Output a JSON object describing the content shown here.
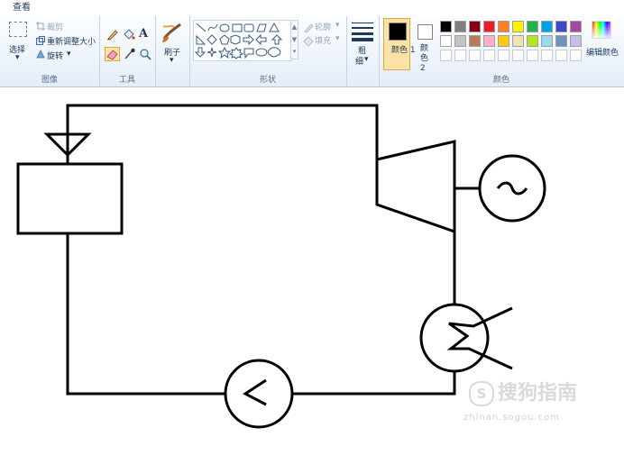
{
  "tabs": {
    "view": "查看"
  },
  "image_group": {
    "select_label": "选择",
    "crop_label": "裁剪",
    "resize_label": "重新调整大小",
    "rotate_label": "旋转",
    "group_label": "图像"
  },
  "tools_group": {
    "text_tool": "A",
    "group_label": "工具"
  },
  "brush_group": {
    "brush_label": "刷子"
  },
  "shapes_group": {
    "outline_label": "轮廓",
    "fill_label": "填充",
    "group_label": "形状"
  },
  "size_group": {
    "label_line1": "粗",
    "label_line2": "细"
  },
  "colors_group": {
    "color1_label": "颜色 1",
    "color2_label": "颜色 2",
    "edit_colors_label": "编辑颜色",
    "group_label": "颜色",
    "color1_value": "#000000",
    "color2_value": "#ffffff",
    "palette_row1": [
      "#000000",
      "#7f7f7f",
      "#880015",
      "#ed1c24",
      "#ff7f27",
      "#fff200",
      "#22b14c",
      "#00a2e8",
      "#3f48cc",
      "#a349a4"
    ],
    "palette_row2": [
      "#ffffff",
      "#c3c3c3",
      "#b97a57",
      "#ffaec9",
      "#ffc90e",
      "#efe4b0",
      "#b5e61d",
      "#99d9ea",
      "#7092be",
      "#c8bfe7"
    ]
  },
  "watermark": {
    "brand": "搜狗指南",
    "url": "zhinan.sogou.com"
  }
}
